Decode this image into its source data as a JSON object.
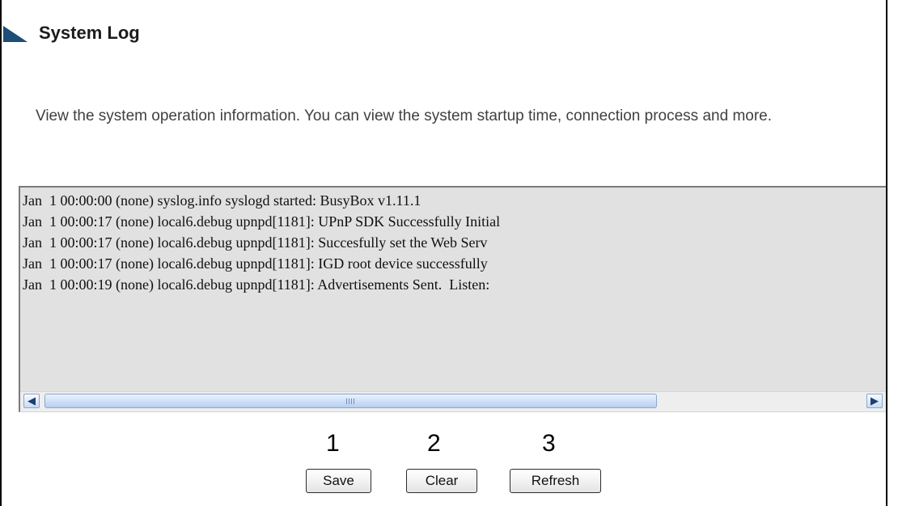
{
  "header": {
    "title": "System Log",
    "description": "View the system operation information. You can view the system startup time, connection process and more."
  },
  "log": {
    "lines": [
      "Jan  1 00:00:00 (none) syslog.info syslogd started: BusyBox v1.11.1",
      "Jan  1 00:00:17 (none) local6.debug upnpd[1181]: UPnP SDK Successfully Initial",
      "Jan  1 00:00:17 (none) local6.debug upnpd[1181]: Succesfully set the Web Serv",
      "Jan  1 00:00:17 (none) local6.debug upnpd[1181]: IGD root device successfully",
      "Jan  1 00:00:19 (none) local6.debug upnpd[1181]: Advertisements Sent.  Listen:"
    ],
    "scroll_left_icon": "arrow-left-icon",
    "scroll_right_icon": "arrow-right-icon"
  },
  "annotations": {
    "save_number": "1",
    "clear_number": "2",
    "refresh_number": "3"
  },
  "buttons": {
    "save": "Save",
    "clear": "Clear",
    "refresh": "Refresh"
  },
  "colors": {
    "title_marker": "#1e4d78",
    "log_background": "#e1e1e1",
    "scrollbar_thumb": "#b6cff0"
  }
}
